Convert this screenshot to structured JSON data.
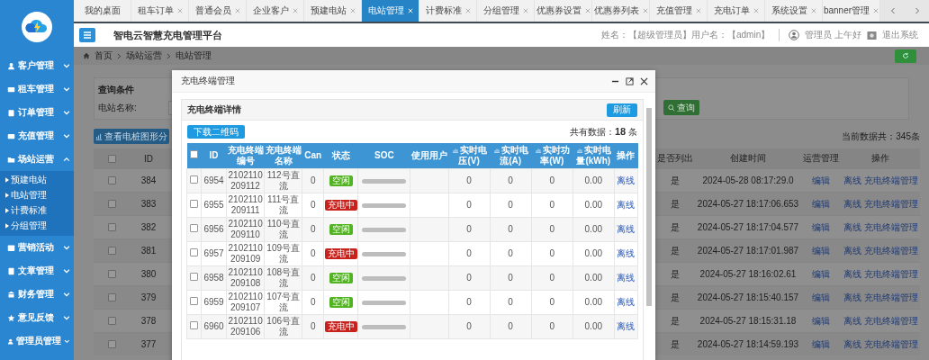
{
  "sidebar": {
    "items": [
      {
        "label": "客户管理",
        "expanded": false
      },
      {
        "label": "租车管理",
        "expanded": false
      },
      {
        "label": "订单管理",
        "expanded": false
      },
      {
        "label": "充值管理",
        "expanded": false
      },
      {
        "label": "场站运营",
        "expanded": true,
        "children": [
          {
            "label": "预建电站"
          },
          {
            "label": "电站管理"
          },
          {
            "label": "计费标准"
          },
          {
            "label": "分组管理"
          }
        ]
      },
      {
        "label": "营销活动",
        "expanded": false
      },
      {
        "label": "文章管理",
        "expanded": false
      },
      {
        "label": "财务管理",
        "expanded": false
      },
      {
        "label": "意见反馈",
        "expanded": false
      },
      {
        "label": "管理员管理",
        "expanded": false
      }
    ]
  },
  "tabs": [
    {
      "label": "我的桌面",
      "selected": false,
      "closable": false
    },
    {
      "label": "租车订单",
      "selected": false,
      "closable": true
    },
    {
      "label": "普通会员",
      "selected": false,
      "closable": true
    },
    {
      "label": "企业客户",
      "selected": false,
      "closable": true
    },
    {
      "label": "预建电站",
      "selected": false,
      "closable": true
    },
    {
      "label": "电站管理",
      "selected": true,
      "closable": true
    },
    {
      "label": "计费标准",
      "selected": false,
      "closable": true
    },
    {
      "label": "分组管理",
      "selected": false,
      "closable": true
    },
    {
      "label": "优惠券设置",
      "selected": false,
      "closable": true
    },
    {
      "label": "优惠券列表",
      "selected": false,
      "closable": true
    },
    {
      "label": "充值管理",
      "selected": false,
      "closable": true
    },
    {
      "label": "充电订单",
      "selected": false,
      "closable": true
    },
    {
      "label": "系统设置",
      "selected": false,
      "closable": true
    },
    {
      "label": "banner管理",
      "selected": false,
      "closable": true
    }
  ],
  "header": {
    "title": "智电云智慧充电管理平台",
    "user_info": "姓名：【超级管理员】用户名：【admin】",
    "greeting": "管理员 上午好",
    "logout": "退出系统"
  },
  "breadcrumb": [
    "首页",
    "场站运营",
    "电站管理"
  ],
  "search": {
    "title": "查询条件",
    "field_label": "电站名称:",
    "button": "查询"
  },
  "chart_button": "查看电桩图形分",
  "total": "当前数据共：345条",
  "station_table": {
    "all_checked": false,
    "columns": [
      "ID",
      "是否列出",
      "创建时间",
      "运营管理",
      "操作"
    ],
    "rows": [
      {
        "checked": false,
        "id": "384",
        "listed": "是",
        "created": "2024-05-28 08:17:29.0",
        "edit": "编辑",
        "actions": [
          "离线",
          "充电终端管理"
        ]
      },
      {
        "checked": false,
        "id": "383",
        "listed": "是",
        "created": "2024-05-27 18:17:06.653",
        "edit": "编辑",
        "actions": [
          "离线",
          "充电终端管理"
        ]
      },
      {
        "checked": false,
        "id": "382",
        "listed": "是",
        "created": "2024-05-27 18:17:04.577",
        "edit": "编辑",
        "actions": [
          "离线",
          "充电终端管理"
        ]
      },
      {
        "checked": false,
        "id": "381",
        "listed": "是",
        "created": "2024-05-27 18:17:01.987",
        "edit": "编辑",
        "actions": [
          "离线",
          "充电终端管理"
        ]
      },
      {
        "checked": false,
        "id": "380",
        "listed": "是",
        "created": "2024-05-27 18:16:02.61",
        "edit": "编辑",
        "actions": [
          "离线",
          "充电终端管理"
        ]
      },
      {
        "checked": false,
        "id": "379",
        "listed": "是",
        "created": "2024-05-27 18:15:40.157",
        "edit": "编辑",
        "actions": [
          "离线",
          "充电终端管理"
        ]
      },
      {
        "checked": false,
        "id": "378",
        "listed": "是",
        "created": "2024-05-27 18:15:31.18",
        "edit": "编辑",
        "actions": [
          "离线",
          "充电终端管理"
        ]
      },
      {
        "checked": false,
        "id": "377",
        "listed": "是",
        "created": "2024-05-27 18:14:59.193",
        "edit": "编辑",
        "actions": [
          "离线",
          "充电终端管理"
        ]
      }
    ]
  },
  "modal": {
    "title": "充电终端管理",
    "panel_title": "充电终端详情",
    "refresh": "刷新",
    "download": "下载二维码",
    "count_label": "共有数据：",
    "count": "18",
    "count_unit": "条",
    "all_checked": false,
    "columns": [
      {
        "label": "ID",
        "has_icon": false
      },
      {
        "label": "充电终端编号",
        "has_icon": false
      },
      {
        "label": "充电终端名称",
        "has_icon": false
      },
      {
        "label": "Can",
        "has_icon": false
      },
      {
        "label": "状态",
        "has_icon": false
      },
      {
        "label": "SOC",
        "has_icon": false
      },
      {
        "label": "使用用户",
        "has_icon": false
      },
      {
        "label": "实时电压(V)",
        "has_icon": true
      },
      {
        "label": "实时电流(A)",
        "has_icon": true
      },
      {
        "label": "实时功率(W)",
        "has_icon": true
      },
      {
        "label": "实时电量(kWh)",
        "has_icon": true
      },
      {
        "label": "操作",
        "has_icon": false
      }
    ],
    "rows": [
      {
        "checked": false,
        "id": "6954",
        "code": "2102110209112",
        "name": "112号直流",
        "can": "0",
        "status": {
          "text": "空闲",
          "color": "#52b322"
        },
        "level": 0,
        "voltage": "0",
        "current": "0",
        "power": "0",
        "energy": "0.00",
        "action": "离线"
      },
      {
        "checked": false,
        "id": "6955",
        "code": "2102110209111",
        "name": "111号直流",
        "can": "0",
        "status": {
          "text": "充电中",
          "color": "#c9221c"
        },
        "level": 0,
        "voltage": "0",
        "current": "0",
        "power": "0",
        "energy": "0.00",
        "action": "离线"
      },
      {
        "checked": false,
        "id": "6956",
        "code": "2102110209110",
        "name": "110号直流",
        "can": "0",
        "status": {
          "text": "空闲",
          "color": "#52b322"
        },
        "level": 0,
        "voltage": "0",
        "current": "0",
        "power": "0",
        "energy": "0.00",
        "action": "离线"
      },
      {
        "checked": false,
        "id": "6957",
        "code": "2102110209109",
        "name": "109号直流",
        "can": "0",
        "status": {
          "text": "充电中",
          "color": "#c9221c"
        },
        "level": 0,
        "voltage": "0",
        "current": "0",
        "power": "0",
        "energy": "0.00",
        "action": "离线"
      },
      {
        "checked": false,
        "id": "6958",
        "code": "2102110209108",
        "name": "108号直流",
        "can": "0",
        "status": {
          "text": "空闲",
          "color": "#52b322"
        },
        "level": 0,
        "voltage": "0",
        "current": "0",
        "power": "0",
        "energy": "0.00",
        "action": "离线"
      },
      {
        "checked": false,
        "id": "6959",
        "code": "2102110209107",
        "name": "107号直流",
        "can": "0",
        "status": {
          "text": "空闲",
          "color": "#52b322"
        },
        "level": 0,
        "voltage": "0",
        "current": "0",
        "power": "0",
        "energy": "0.00",
        "action": "离线"
      },
      {
        "checked": false,
        "id": "6960",
        "code": "2102110209106",
        "name": "106号直流",
        "can": "0",
        "status": {
          "text": "充电中",
          "color": "#c9221c"
        },
        "level": 0,
        "voltage": "0",
        "current": "0",
        "power": "0",
        "energy": "0.00",
        "action": "离线"
      }
    ]
  }
}
